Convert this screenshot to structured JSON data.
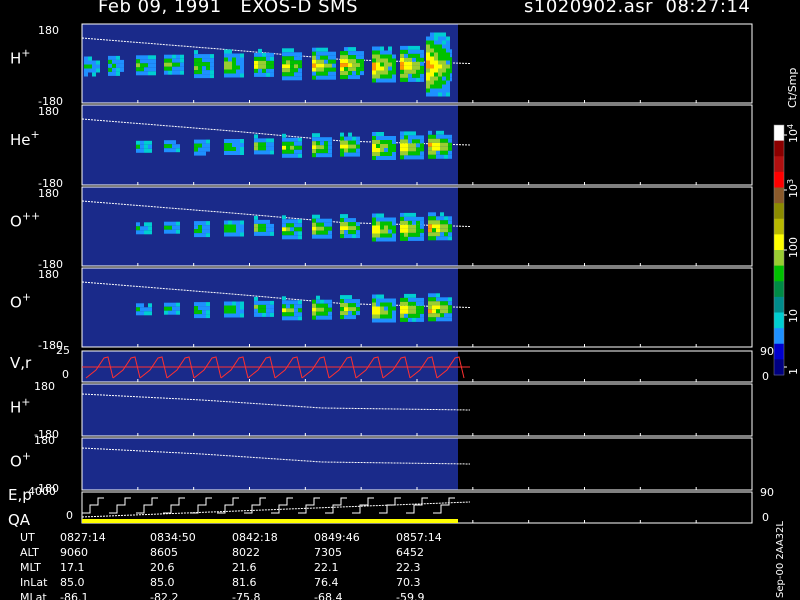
{
  "header": {
    "left_title": "Feb 09, 1991   EXOS-D SMS",
    "right_title": "s1020902.asr  08:27:14"
  },
  "panels": [
    {
      "label": "H",
      "sup": "+",
      "ymax": "180",
      "ymin": "-180",
      "kind": "spectro"
    },
    {
      "label": "He",
      "sup": "+",
      "ymax": "180",
      "ymin": "-180",
      "kind": "spectro"
    },
    {
      "label": "O",
      "sup": "++",
      "ymax": "180",
      "ymin": "-180",
      "kind": "spectro"
    },
    {
      "label": "O",
      "sup": "+",
      "ymax": "180",
      "ymin": "-180",
      "kind": "spectro"
    },
    {
      "label": "V,r",
      "sup": "",
      "ymax": "25",
      "ymin": "0",
      "kind": "vr",
      "right_top": "90",
      "right_bottom": "0"
    },
    {
      "label": "H",
      "sup": "+",
      "ymax": "180",
      "ymin": "-180",
      "kind": "small"
    },
    {
      "label": "O",
      "sup": "+",
      "ymax": "180",
      "ymin": "-180",
      "kind": "small"
    },
    {
      "label": "E,p",
      "sup": "",
      "ymax": "4000",
      "ymin": "0",
      "kind": "ep",
      "right_top": "90",
      "right_bottom": "0",
      "extra_label": "QA"
    }
  ],
  "colorbar": {
    "unit": "Ct/Smp",
    "ticks": [
      "10^4",
      "10^3",
      "100",
      "10",
      "1"
    ],
    "colors": [
      "#ffffff",
      "#8b0000",
      "#b01010",
      "#ff0000",
      "#8b5a2b",
      "#8b8b00",
      "#b8b800",
      "#ffff00",
      "#9acd32",
      "#00c000",
      "#008b45",
      "#008b8b",
      "#00ced1",
      "#1e90ff",
      "#0000cd",
      "#000080"
    ]
  },
  "ephemeris": {
    "rows": [
      {
        "name": "UT",
        "values": [
          "0827:14",
          "0834:50",
          "0842:18",
          "0849:46",
          "0857:14"
        ]
      },
      {
        "name": "ALT",
        "values": [
          "9060",
          "8605",
          "8022",
          "7305",
          "6452"
        ]
      },
      {
        "name": "MLT",
        "values": [
          "17.1",
          "20.6",
          "21.6",
          "22.1",
          "22.3"
        ]
      },
      {
        "name": "InLat",
        "values": [
          "85.0",
          "85.0",
          "81.6",
          "76.4",
          "70.3"
        ]
      },
      {
        "name": "MLat",
        "values": [
          "-86.1",
          "-82.2",
          "-75.8",
          "-68.4",
          "-59.9"
        ]
      }
    ]
  },
  "footer_stamp": "Sep-00 2AA32L",
  "chart_data": {
    "type": "heatmap",
    "title": "Feb 09, 1991   EXOS-D SMS",
    "xlabel": "UT",
    "x": [
      "0827:14",
      "0834:50",
      "0842:18",
      "0849:46",
      "0857:14"
    ],
    "ylim": [
      -180,
      180
    ],
    "series": [
      {
        "name": "H+",
        "ylim": [
          -180,
          180
        ]
      },
      {
        "name": "He+",
        "ylim": [
          -180,
          180
        ]
      },
      {
        "name": "O++",
        "ylim": [
          -180,
          180
        ]
      },
      {
        "name": "O+",
        "ylim": [
          -180,
          180
        ]
      },
      {
        "name": "V,r",
        "ylim": [
          0,
          25
        ]
      },
      {
        "name": "H+",
        "ylim": [
          -180,
          180
        ]
      },
      {
        "name": "O+",
        "ylim": [
          -180,
          180
        ]
      },
      {
        "name": "E,p",
        "ylim": [
          0,
          4000
        ]
      }
    ],
    "colorbar_unit": "Ct/Smp",
    "colorbar_range": [
      1,
      10000
    ],
    "colorbar_scale": "log"
  }
}
